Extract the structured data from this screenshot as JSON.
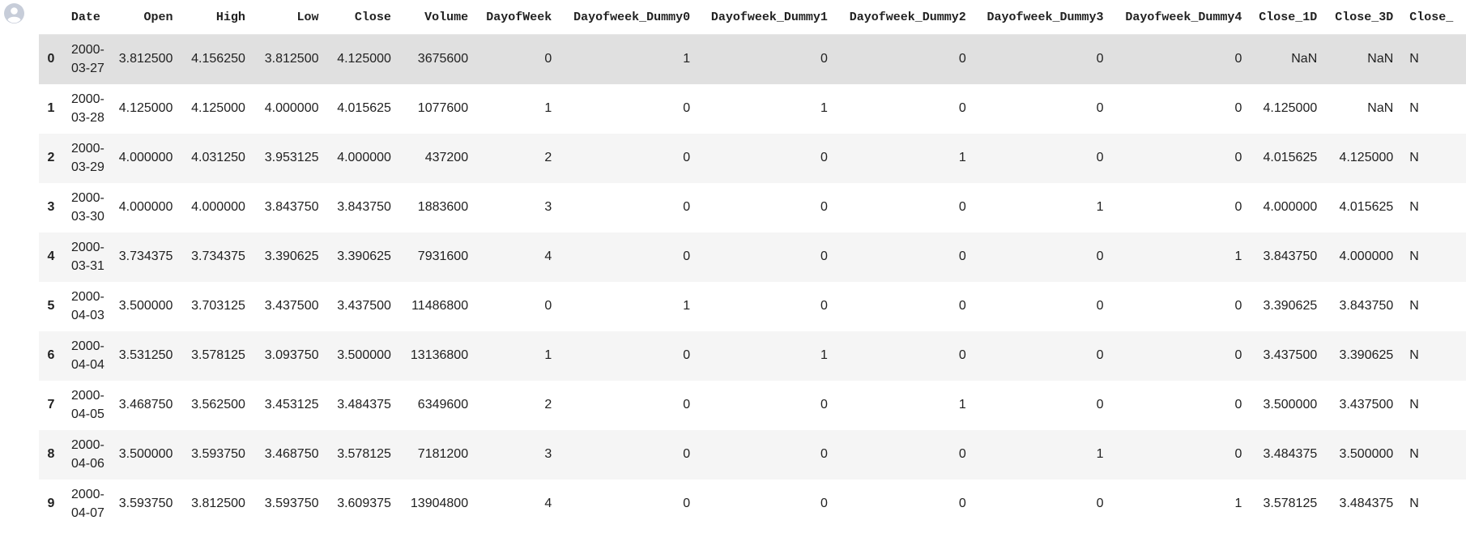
{
  "table": {
    "columns": [
      "",
      "Date",
      "Open",
      "High",
      "Low",
      "Close",
      "Volume",
      "DayofWeek",
      "Dayofweek_Dummy0",
      "Dayofweek_Dummy1",
      "Dayofweek_Dummy2",
      "Dayofweek_Dummy3",
      "Dayofweek_Dummy4",
      "Close_1D",
      "Close_3D",
      "Close_"
    ],
    "rows": [
      [
        "0",
        "2000-03-27",
        "3.812500",
        "4.156250",
        "3.812500",
        "4.125000",
        "3675600",
        "0",
        "1",
        "0",
        "0",
        "0",
        "0",
        "NaN",
        "NaN",
        "N"
      ],
      [
        "1",
        "2000-03-28",
        "4.125000",
        "4.125000",
        "4.000000",
        "4.015625",
        "1077600",
        "1",
        "0",
        "1",
        "0",
        "0",
        "0",
        "4.125000",
        "NaN",
        "N"
      ],
      [
        "2",
        "2000-03-29",
        "4.000000",
        "4.031250",
        "3.953125",
        "4.000000",
        "437200",
        "2",
        "0",
        "0",
        "1",
        "0",
        "0",
        "4.015625",
        "4.125000",
        "N"
      ],
      [
        "3",
        "2000-03-30",
        "4.000000",
        "4.000000",
        "3.843750",
        "3.843750",
        "1883600",
        "3",
        "0",
        "0",
        "0",
        "1",
        "0",
        "4.000000",
        "4.015625",
        "N"
      ],
      [
        "4",
        "2000-03-31",
        "3.734375",
        "3.734375",
        "3.390625",
        "3.390625",
        "7931600",
        "4",
        "0",
        "0",
        "0",
        "0",
        "1",
        "3.843750",
        "4.000000",
        "N"
      ],
      [
        "5",
        "2000-04-03",
        "3.500000",
        "3.703125",
        "3.437500",
        "3.437500",
        "11486800",
        "0",
        "1",
        "0",
        "0",
        "0",
        "0",
        "3.390625",
        "3.843750",
        "N"
      ],
      [
        "6",
        "2000-04-04",
        "3.531250",
        "3.578125",
        "3.093750",
        "3.500000",
        "13136800",
        "1",
        "0",
        "1",
        "0",
        "0",
        "0",
        "3.437500",
        "3.390625",
        "N"
      ],
      [
        "7",
        "2000-04-05",
        "3.468750",
        "3.562500",
        "3.453125",
        "3.484375",
        "6349600",
        "2",
        "0",
        "0",
        "1",
        "0",
        "0",
        "3.500000",
        "3.437500",
        "N"
      ],
      [
        "8",
        "2000-04-06",
        "3.500000",
        "3.593750",
        "3.468750",
        "3.578125",
        "7181200",
        "3",
        "0",
        "0",
        "0",
        "1",
        "0",
        "3.484375",
        "3.500000",
        "N"
      ],
      [
        "9",
        "2000-04-07",
        "3.593750",
        "3.812500",
        "3.593750",
        "3.609375",
        "13904800",
        "4",
        "0",
        "0",
        "0",
        "0",
        "1",
        "3.578125",
        "3.484375",
        "N"
      ]
    ],
    "hovered_row": 0
  },
  "avatar": {
    "icon": "user-avatar-icon",
    "color": "#c7cdd9"
  },
  "colors": {
    "row_odd": "#f5f5f5",
    "row_even": "#ffffff",
    "row_hover": "#e0e0e0"
  }
}
